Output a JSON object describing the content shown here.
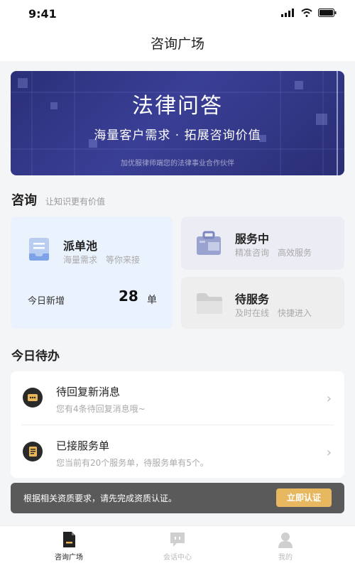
{
  "status_bar": {
    "time": "9:41"
  },
  "nav": {
    "title": "咨询广场"
  },
  "banner": {
    "title": "法律问答",
    "subtitle": "海量客户需求 · 拓展咨询价值",
    "footnote": "加优服律师端您的法律事业合作伙伴"
  },
  "consult": {
    "title": "咨询",
    "subtitle": "让知识更有价值",
    "pool": {
      "title": "派单池",
      "desc": "海量需求　等你来接",
      "stat_label": "今日新增",
      "stat_value": "28",
      "stat_unit": "单"
    },
    "serving": {
      "title": "服务中",
      "desc": "精准咨询　高效服务"
    },
    "waiting": {
      "title": "待服务",
      "desc": "及时在线　快捷进入"
    }
  },
  "todo": {
    "title": "今日待办",
    "items": [
      {
        "title": "待回复新消息",
        "desc": "您有4条待回复消息哦~"
      },
      {
        "title": "已接服务单",
        "desc": "您当前有20个服务单，待服务单有5个。"
      }
    ]
  },
  "notice": {
    "text": "根据相关资质要求，请先完成资质认证。",
    "button": "立即认证"
  },
  "tabs": [
    {
      "label": "咨询广场",
      "icon": "document-icon",
      "active": true
    },
    {
      "label": "会话中心",
      "icon": "chat-icon",
      "active": false
    },
    {
      "label": "我的",
      "icon": "user-icon",
      "active": false
    }
  ],
  "colors": {
    "banner": "#2b2f78",
    "pool_card": "#eaf2fd",
    "serving_card": "#ececf5",
    "notice_bg": "#5a5a5a",
    "notice_button": "#e8b860"
  }
}
